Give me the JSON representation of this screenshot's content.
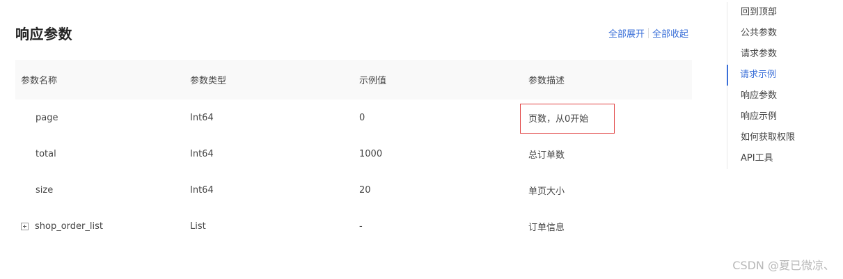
{
  "section": {
    "title": "响应参数",
    "expand_all": "全部展开",
    "collapse_all": "全部收起"
  },
  "table": {
    "headers": [
      "参数名称",
      "参数类型",
      "示例值",
      "参数描述"
    ],
    "rows": [
      {
        "name": "page",
        "type": "Int64",
        "example": "0",
        "desc": "页数，从0开始"
      },
      {
        "name": "total",
        "type": "Int64",
        "example": "1000",
        "desc": "总订单数"
      },
      {
        "name": "size",
        "type": "Int64",
        "example": "20",
        "desc": "单页大小"
      },
      {
        "name": "shop_order_list",
        "type": "List",
        "example": "-",
        "desc": "订单信息"
      }
    ]
  },
  "toc": {
    "items": [
      "回到顶部",
      "公共参数",
      "请求参数",
      "请求示例",
      "响应参数",
      "响应示例",
      "如何获取权限",
      "API工具"
    ],
    "active": "请求示例"
  },
  "watermark": "CSDN @夏已微凉、",
  "colors": {
    "link": "#3a6fd8",
    "highlight_border": "#e04040",
    "header_bg": "#f9f9f9"
  }
}
